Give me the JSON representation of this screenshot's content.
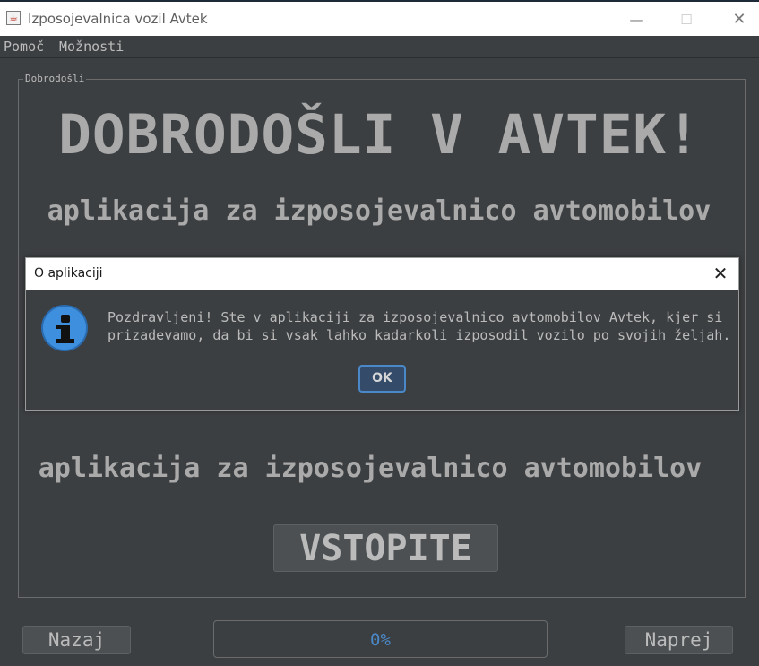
{
  "window": {
    "title": "Izposojevalnica vozil Avtek",
    "app_icon": "java-cup-icon",
    "controls": {
      "minimize": "—",
      "maximize": "☐",
      "close": "✕"
    }
  },
  "menu": {
    "items": [
      "Pomoč",
      "Možnosti"
    ]
  },
  "main": {
    "panel_title": "Dobrodošli",
    "headline": "DOBRODOŠLI V AVTEK!",
    "subtitle_top": "aplikacija za izposojevalnico avtomobilov",
    "subtitle_bottom": "aplikacija za izposojevalnico avtomobilov",
    "enter_button": "VSTOPITE"
  },
  "footer": {
    "back_button": "Nazaj",
    "next_button": "Naprej",
    "progress_text": "0%",
    "progress_value": 0
  },
  "dialog": {
    "title": "O aplikaciji",
    "close_glyph": "✕",
    "icon": "info-icon",
    "message_line1": "Pozdravljeni! Ste v aplikaciji za izposojevalnico avtomobilov Avtek, kjer si",
    "message_line2": "prizadevamo, da bi si vsak lahko kadarkoli izposodil vozilo po svojih željah.",
    "ok_button": "OK"
  },
  "colors": {
    "background": "#3c3f41",
    "text": "#bbbbbb",
    "accent": "#4a88c7"
  }
}
